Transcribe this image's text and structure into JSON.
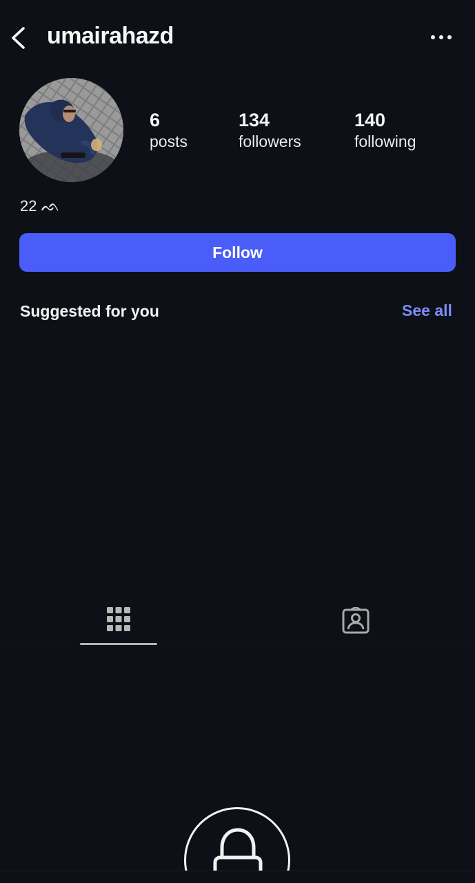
{
  "header": {
    "username": "umairahazd",
    "back_icon": "chevron-left-icon",
    "more_icon": "more-horizontal-icon"
  },
  "profile": {
    "avatar_icon": "profile-photo",
    "stats": {
      "posts": {
        "count": "6",
        "label": "posts"
      },
      "followers": {
        "count": "134",
        "label": "followers"
      },
      "following": {
        "count": "140",
        "label": "following"
      }
    },
    "bio": "22 ᨒ"
  },
  "actions": {
    "follow_label": "Follow",
    "follow_color": "#4a5df8"
  },
  "suggested": {
    "title": "Suggested for you",
    "see_all_label": "See all",
    "see_all_color": "#7e8cf9"
  },
  "tabs": [
    {
      "icon": "grid-icon",
      "active": true
    },
    {
      "icon": "tagged-person-icon",
      "active": false
    }
  ],
  "private_state": {
    "icon": "lock-icon"
  },
  "colors": {
    "background": "#0d1016",
    "text": "#f5f5f5"
  }
}
